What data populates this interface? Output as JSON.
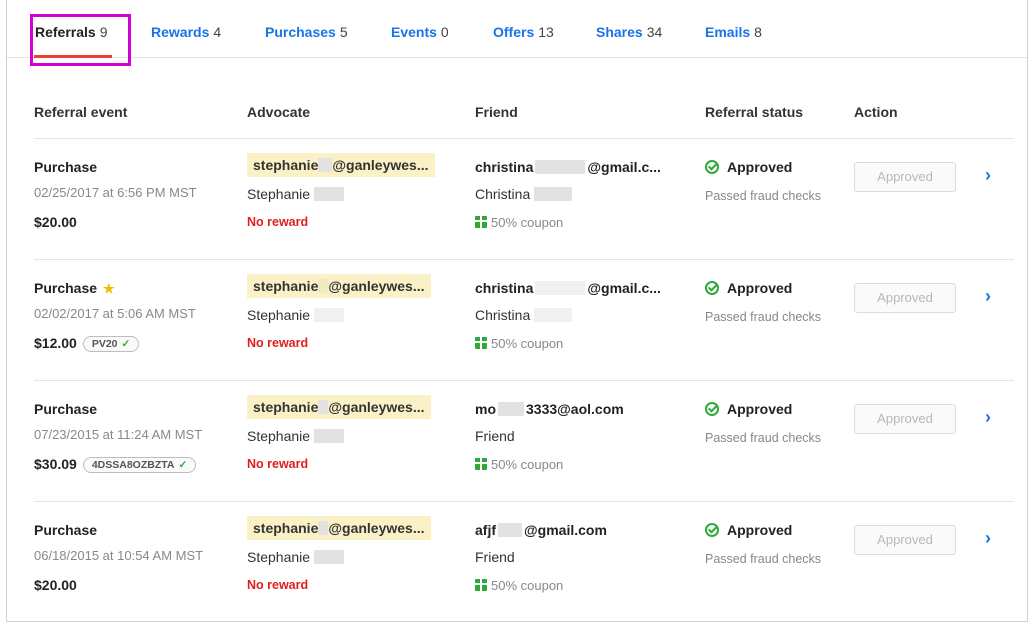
{
  "tabs": [
    {
      "label": "Referrals",
      "count": "9"
    },
    {
      "label": "Rewards",
      "count": "4"
    },
    {
      "label": "Purchases",
      "count": "5"
    },
    {
      "label": "Events",
      "count": "0"
    },
    {
      "label": "Offers",
      "count": "13"
    },
    {
      "label": "Shares",
      "count": "34"
    },
    {
      "label": "Emails",
      "count": "8"
    }
  ],
  "columns": [
    "Referral event",
    "Advocate",
    "Friend",
    "Referral status",
    "Action"
  ],
  "rows": [
    {
      "event": "Purchase",
      "date": "02/25/2017 at 6:56 PM MST",
      "amount": "$20.00",
      "code": "",
      "advocate_email_a": "stephanie",
      "advocate_email_b": "@ganleywes...",
      "advocate_name": "Stephanie",
      "advocate_reward": "No reward",
      "friend_email_a": "christina",
      "friend_email_b": "@gmail.c...",
      "friend_name": "Christina",
      "friend_reward": "50% coupon",
      "status": "Approved",
      "status_note": "Passed fraud checks",
      "action": "Approved"
    },
    {
      "event": "Purchase",
      "date": "02/02/2017 at 5:06 AM MST",
      "amount": "$12.00",
      "code": "PV20",
      "advocate_email_a": "stephanie",
      "advocate_email_b": "@ganleywes...",
      "advocate_name": "Stephanie",
      "advocate_reward": "No reward",
      "friend_email_a": "christina",
      "friend_email_b": "@gmail.c...",
      "friend_name": "Christina",
      "friend_reward": "50% coupon",
      "status": "Approved",
      "status_note": "Passed fraud checks",
      "action": "Approved"
    },
    {
      "event": "Purchase",
      "date": "07/23/2015 at 11:24 AM MST",
      "amount": "$30.09",
      "code": "4DSSA8OZBZTA",
      "advocate_email_a": "stephanie",
      "advocate_email_b": "@ganleywes...",
      "advocate_name": "Stephanie",
      "advocate_reward": "No reward",
      "friend_email_a": "mo",
      "friend_email_b": "3333@aol.com",
      "friend_name": "Friend",
      "friend_reward": "50% coupon",
      "status": "Approved",
      "status_note": "Passed fraud checks",
      "action": "Approved"
    },
    {
      "event": "Purchase",
      "date": "06/18/2015 at 10:54 AM MST",
      "amount": "$20.00",
      "code": "",
      "advocate_email_a": "stephanie",
      "advocate_email_b": "@ganleywes...",
      "advocate_name": "Stephanie",
      "advocate_reward": "No reward",
      "friend_email_a": "afjf",
      "friend_email_b": "@gmail.com",
      "friend_name": "Friend",
      "friend_reward": "50% coupon",
      "status": "Approved",
      "status_note": "Passed fraud checks",
      "action": "Approved"
    }
  ],
  "colors": {
    "link": "#1a73e8",
    "accent_underline": "#e8432f",
    "highlight_box": "#d400d4",
    "reward_none": "#e01e1e",
    "approved_green": "#2eaa3a",
    "email_chip": "#fbf1c7"
  }
}
